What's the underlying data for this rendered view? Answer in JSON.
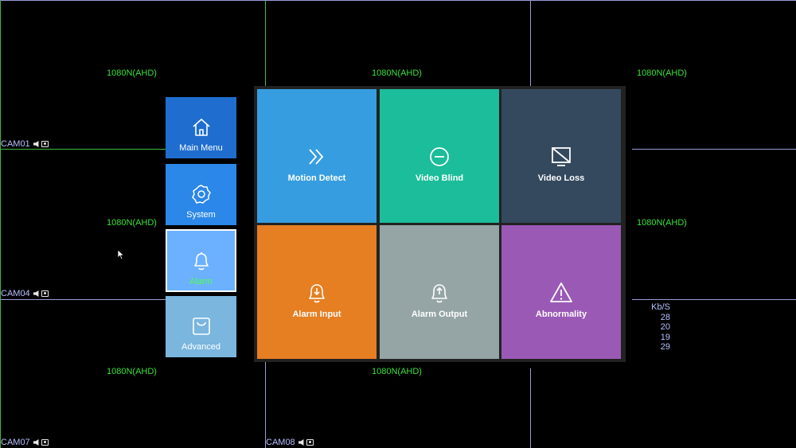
{
  "grid": {
    "resolution_labels": [
      "1080N(AHD)",
      "1080N(AHD)",
      "1080N(AHD)",
      "1080N(AHD)",
      "1080N(AHD)",
      "1080N(AHD)",
      "1080N(AHD)"
    ],
    "cameras": [
      "CAM01",
      "CAM04",
      "CAM07",
      "CAM08"
    ]
  },
  "bitrate": {
    "header": "Kb/S",
    "values": [
      "28",
      "20",
      "19",
      "29"
    ]
  },
  "sidebar": {
    "items": [
      {
        "label": "Main Menu",
        "icon": "home-icon"
      },
      {
        "label": "System",
        "icon": "gear-icon"
      },
      {
        "label": "Alarm",
        "icon": "bell-icon"
      },
      {
        "label": "Advanced",
        "icon": "bag-icon"
      }
    ]
  },
  "alarm_menu": {
    "tiles": [
      {
        "label": "Motion Detect",
        "icon": "double-chevron-right-icon",
        "color": "#369ee0"
      },
      {
        "label": "Video Blind",
        "icon": "minus-circle-icon",
        "color": "#1bbd9a"
      },
      {
        "label": "Video Loss",
        "icon": "blocked-screen-icon",
        "color": "#34495e"
      },
      {
        "label": "Alarm Input",
        "icon": "bell-down-icon",
        "color": "#e67e22"
      },
      {
        "label": "Alarm Output",
        "icon": "bell-up-icon",
        "color": "#95a5a6"
      },
      {
        "label": "Abnormality",
        "icon": "warning-icon",
        "color": "#9b59b6"
      }
    ]
  },
  "colors": {
    "sidebar_main_menu": "#1f6ecf",
    "sidebar_system": "#2b87e8",
    "sidebar_alarm": "#6cb1ff",
    "sidebar_advanced": "#7ab6de",
    "alarm_label": "#4dff4d"
  }
}
